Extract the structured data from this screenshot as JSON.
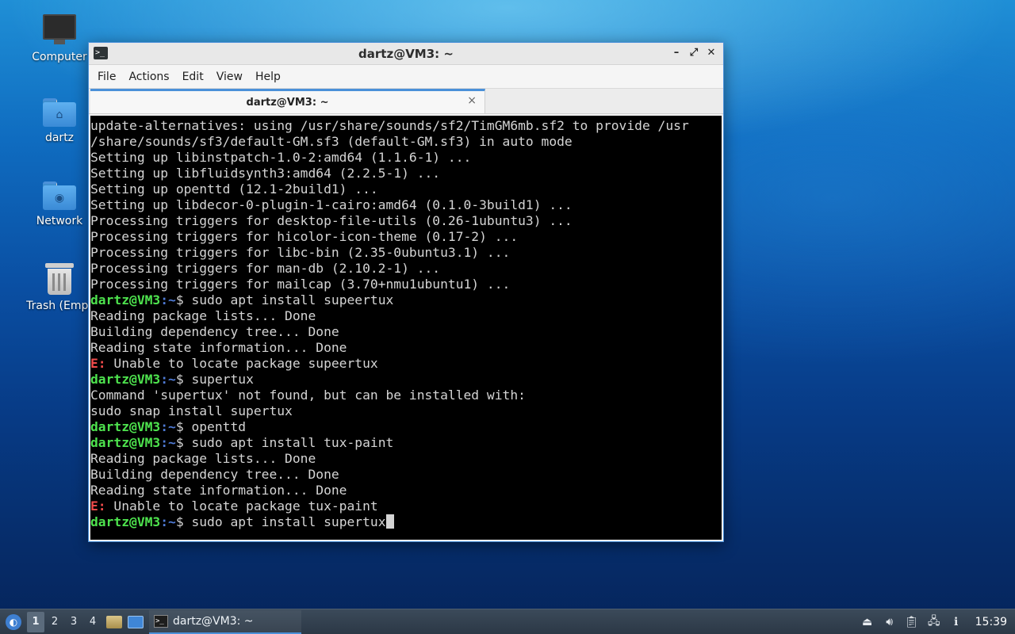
{
  "desktop": {
    "icons": [
      {
        "label": "Computer",
        "icon": "computer-icon"
      },
      {
        "label": "dartz",
        "icon": "home-folder-icon"
      },
      {
        "label": "Network",
        "icon": "network-folder-icon"
      },
      {
        "label": "Trash (Empt",
        "icon": "trash-icon"
      }
    ]
  },
  "window": {
    "title": "dartz@VM3: ~",
    "controls": {
      "minimize": "–",
      "maximize": "⤢",
      "close": "✕"
    },
    "menu": [
      "File",
      "Actions",
      "Edit",
      "View",
      "Help"
    ],
    "tab": {
      "label": "dartz@VM3: ~",
      "close": "×"
    }
  },
  "terminal": {
    "prompt_user": "dartz@VM3",
    "prompt_path": ":~",
    "lines": [
      {
        "type": "out",
        "text": "update-alternatives: using /usr/share/sounds/sf2/TimGM6mb.sf2 to provide /usr"
      },
      {
        "type": "out",
        "text": "/share/sounds/sf3/default-GM.sf3 (default-GM.sf3) in auto mode"
      },
      {
        "type": "out",
        "text": "Setting up libinstpatch-1.0-2:amd64 (1.1.6-1) ..."
      },
      {
        "type": "out",
        "text": "Setting up libfluidsynth3:amd64 (2.2.5-1) ..."
      },
      {
        "type": "out",
        "text": "Setting up openttd (12.1-2build1) ..."
      },
      {
        "type": "out",
        "text": "Setting up libdecor-0-plugin-1-cairo:amd64 (0.1.0-3build1) ..."
      },
      {
        "type": "out",
        "text": "Processing triggers for desktop-file-utils (0.26-1ubuntu3) ..."
      },
      {
        "type": "out",
        "text": "Processing triggers for hicolor-icon-theme (0.17-2) ..."
      },
      {
        "type": "out",
        "text": "Processing triggers for libc-bin (2.35-0ubuntu3.1) ..."
      },
      {
        "type": "out",
        "text": "Processing triggers for man-db (2.10.2-1) ..."
      },
      {
        "type": "out",
        "text": "Processing triggers for mailcap (3.70+nmu1ubuntu1) ..."
      },
      {
        "type": "cmd",
        "text": "$ sudo apt install supeertux"
      },
      {
        "type": "out",
        "text": "Reading package lists... Done"
      },
      {
        "type": "out",
        "text": "Building dependency tree... Done"
      },
      {
        "type": "out",
        "text": "Reading state information... Done"
      },
      {
        "type": "err",
        "prefix": "E:",
        "text": " Unable to locate package supeertux"
      },
      {
        "type": "cmd",
        "text": "$ supertux"
      },
      {
        "type": "out",
        "text": "Command 'supertux' not found, but can be installed with:"
      },
      {
        "type": "out",
        "text": "sudo snap install supertux"
      },
      {
        "type": "cmd",
        "text": "$ openttd"
      },
      {
        "type": "cmd",
        "text": "$ sudo apt install tux-paint"
      },
      {
        "type": "out",
        "text": "Reading package lists... Done"
      },
      {
        "type": "out",
        "text": "Building dependency tree... Done"
      },
      {
        "type": "out",
        "text": "Reading state information... Done"
      },
      {
        "type": "err",
        "prefix": "E:",
        "text": " Unable to locate package tux-paint"
      },
      {
        "type": "cmd",
        "text": "$ sudo apt install supertux",
        "cursor": true
      }
    ]
  },
  "taskbar": {
    "workspaces": [
      "1",
      "2",
      "3",
      "4"
    ],
    "active_workspace": "1",
    "task_label": "dartz@VM3: ~",
    "clock": "15:39"
  },
  "colors": {
    "prompt_user": "#4ee34e",
    "prompt_path": "#4f7bd6",
    "error": "#f04b4b",
    "accent": "#4a90d9"
  }
}
